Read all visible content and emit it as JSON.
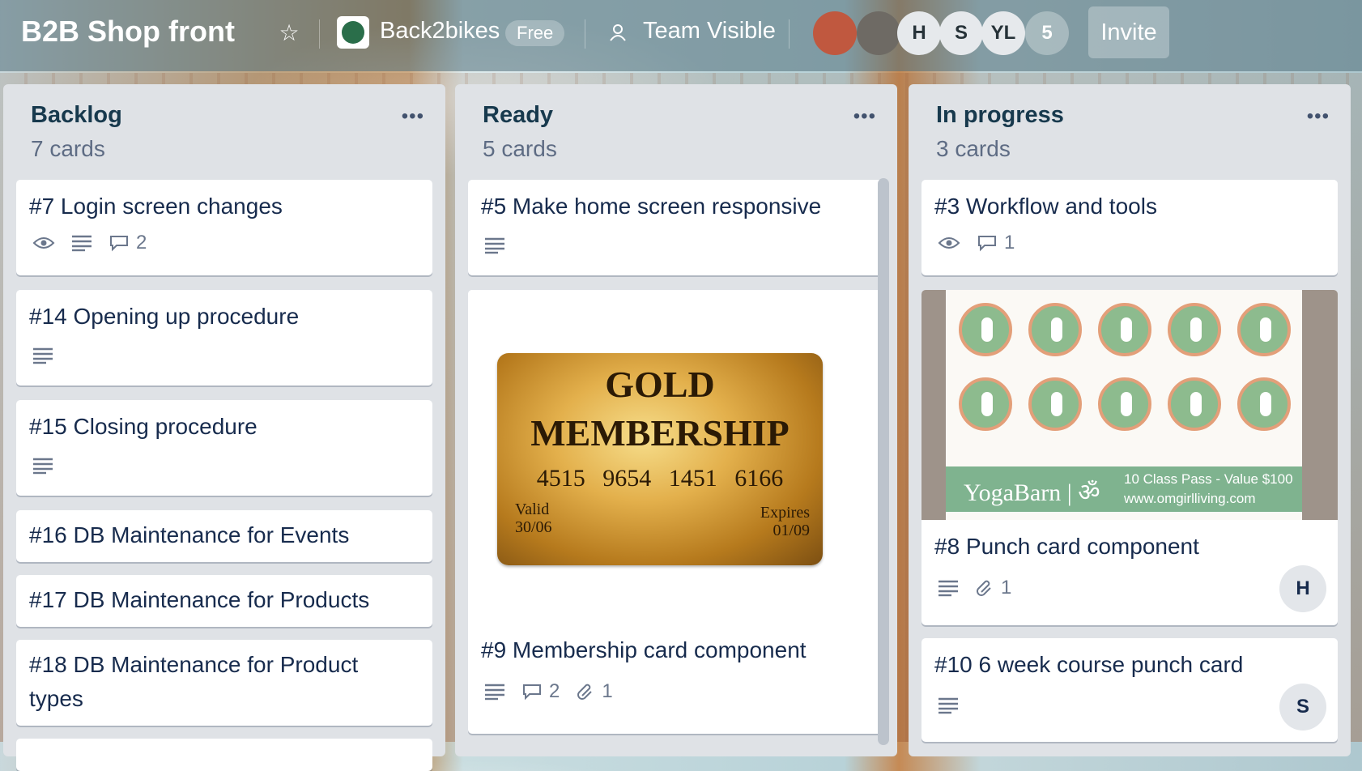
{
  "header": {
    "board_title": "B2B Shop front",
    "org_name": "Back2bikes",
    "plan_badge": "Free",
    "visibility": "Team Visible",
    "members": [
      "H",
      "S",
      "YL"
    ],
    "member_overflow": "5",
    "invite_label": "Invite"
  },
  "lists": [
    {
      "title": "Backlog",
      "count": "7 cards",
      "cards": [
        {
          "title": "#7 Login screen changes",
          "comments": "2"
        },
        {
          "title": "#14 Opening up procedure"
        },
        {
          "title": "#15 Closing procedure"
        },
        {
          "title": "#16 DB Maintenance for Events"
        },
        {
          "title": "#17 DB Maintenance for Products"
        },
        {
          "title": "#18 DB Maintenance for Product types"
        }
      ]
    },
    {
      "title": "Ready",
      "count": "5 cards",
      "cards": [
        {
          "title": "#5 Make home screen responsive"
        },
        {
          "title": "#9 Membership card component",
          "comments": "2",
          "attachments": "1",
          "cover": {
            "line1": "GOLD",
            "line2": "MEMBERSHIP",
            "number": "4515 9654 1451 6166",
            "valid_label": "Valid",
            "valid_value": "30/06",
            "expires_label": "Expires",
            "expires_value": "01/09"
          }
        }
      ]
    },
    {
      "title": "In progress",
      "count": "3 cards",
      "cards": [
        {
          "title": "#3 Workflow and tools",
          "comments": "1"
        },
        {
          "title": "#8 Punch card component",
          "attachments": "1",
          "member": "H",
          "cover": {
            "brand": "YogaBarn | ॐ",
            "line1": "10 Class Pass - Value $100",
            "line2": "www.omgirlliving.com"
          }
        },
        {
          "title": "#10 6 week course punch card",
          "member": "S"
        }
      ]
    }
  ]
}
